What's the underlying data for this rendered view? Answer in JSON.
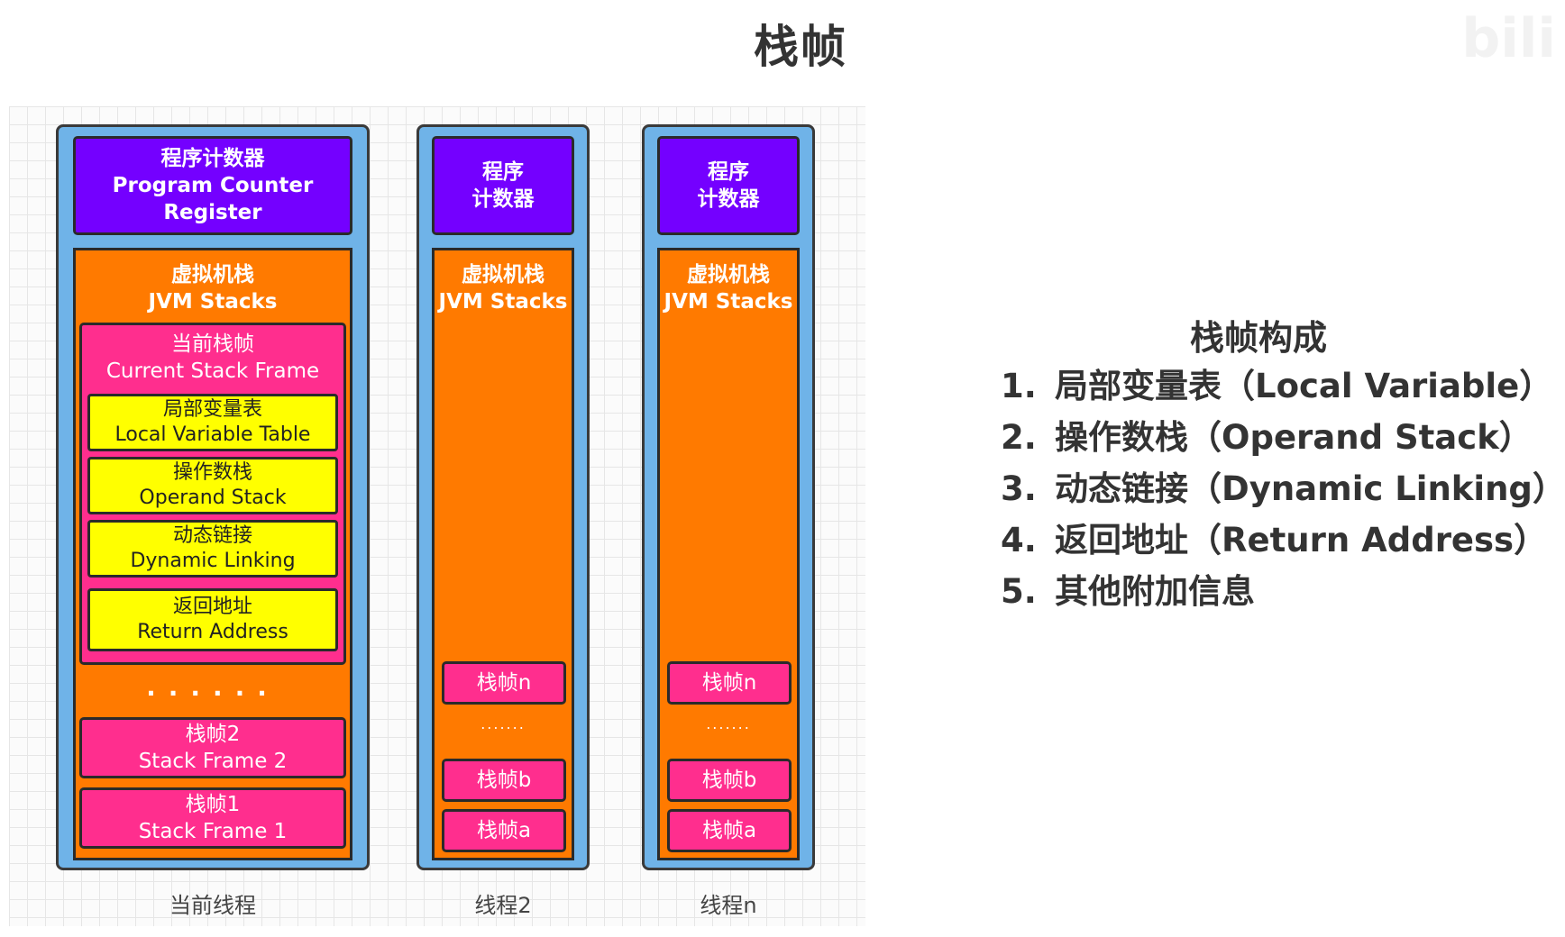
{
  "title": "栈帧",
  "watermark": "bili",
  "threads": [
    {
      "pc_lines": [
        "程序计数器",
        "Program Counter",
        "Register"
      ],
      "jvm_label": [
        "虚拟机栈",
        "JVM Stacks"
      ],
      "current_frame": {
        "label": [
          "当前栈帧",
          "Current Stack Frame"
        ],
        "parts": [
          [
            "局部变量表",
            "Local Variable Table"
          ],
          [
            "操作数栈",
            "Operand Stack"
          ],
          [
            "动态链接",
            "Dynamic Linking"
          ],
          [
            "返回地址",
            "Return Address"
          ]
        ]
      },
      "dots": "......",
      "frames": [
        [
          "栈帧2",
          "Stack Frame 2"
        ],
        [
          "栈帧1",
          "Stack Frame 1"
        ]
      ],
      "caption": "当前线程"
    },
    {
      "pc_lines": [
        "程序",
        "计数器"
      ],
      "jvm_label": [
        "虚拟机栈",
        "JVM Stacks"
      ],
      "frames": [
        "栈帧n",
        "栈帧b",
        "栈帧a"
      ],
      "dots": ".......",
      "caption": "线程2"
    },
    {
      "pc_lines": [
        "程序",
        "计数器"
      ],
      "jvm_label": [
        "虚拟机栈",
        "JVM Stacks"
      ],
      "frames": [
        "栈帧n",
        "栈帧b",
        "栈帧a"
      ],
      "dots": ".......",
      "caption": "线程n"
    }
  ],
  "composition": {
    "title": "栈帧构成",
    "items": [
      {
        "num": "1.",
        "text": "局部变量表（Local Variable）"
      },
      {
        "num": "2.",
        "text": "操作数栈（Operand Stack）"
      },
      {
        "num": "3.",
        "text": "动态链接（Dynamic Linking）"
      },
      {
        "num": "4.",
        "text": "返回地址（Return Address）"
      },
      {
        "num": "5.",
        "text": "其他附加信息"
      }
    ]
  }
}
